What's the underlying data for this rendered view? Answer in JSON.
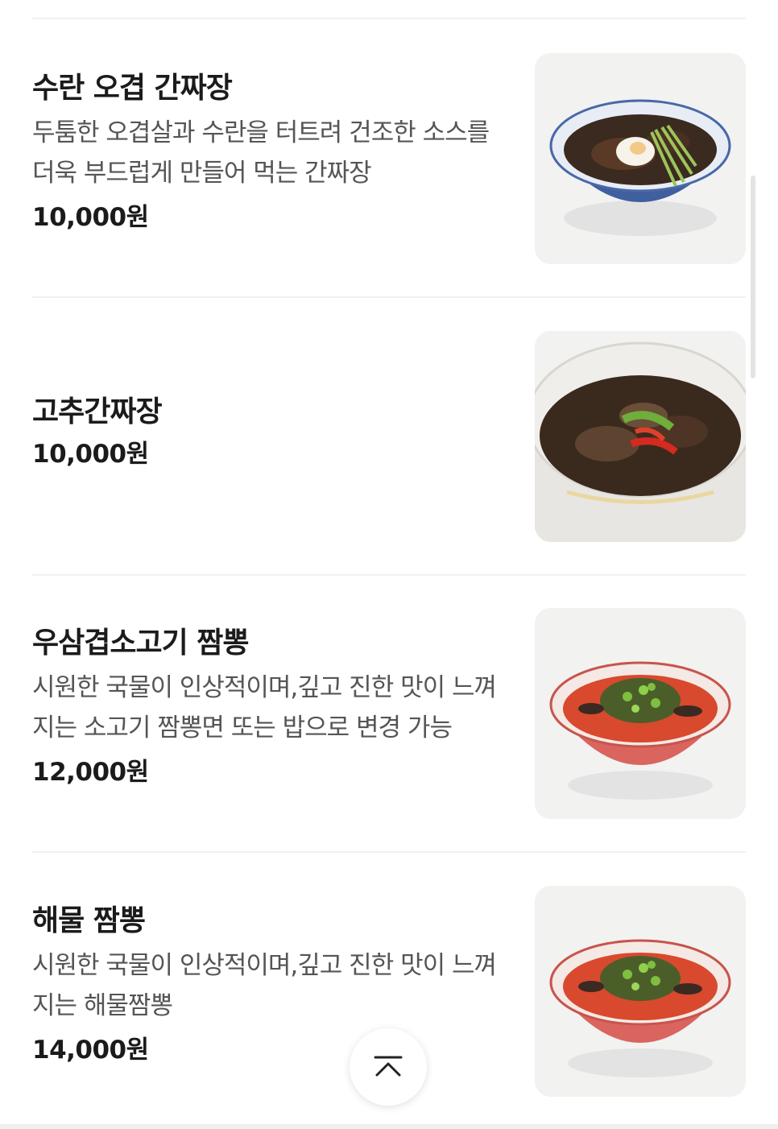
{
  "menu": {
    "items": [
      {
        "name": "수란 오겹 간짜장",
        "description": "두툼한 오겹살과 수란을 터트려 건조한 소스를 더욱 부드럽게 만들어 먹는 간짜장",
        "price": "10,000원",
        "image_icon": "bowl-jajang-egg-icon"
      },
      {
        "name": "고추간짜장",
        "description": "",
        "price": "10,000원",
        "image_icon": "bowl-jajang-pepper-icon"
      },
      {
        "name": "우삼겹소고기 짬뽕",
        "description": "시원한 국물이 인상적이며,깊고 진한 맛이 느껴지는 소고기 짬뽕면 또는 밥으로 변경 가능",
        "price": "12,000원",
        "image_icon": "bowl-jjamppong-beef-icon"
      },
      {
        "name": "해물 짬뽕",
        "description": "시원한 국물이 인상적이며,깊고 진한 맛이 느껴지는 해물짬뽕",
        "price": "14,000원",
        "image_icon": "bowl-jjamppong-seafood-icon"
      }
    ]
  },
  "scroll_top_icon": "chevron-up-icon",
  "colors": {
    "text_primary": "#1b1b1b",
    "text_secondary": "#555555",
    "divider": "#f1f1f1"
  }
}
